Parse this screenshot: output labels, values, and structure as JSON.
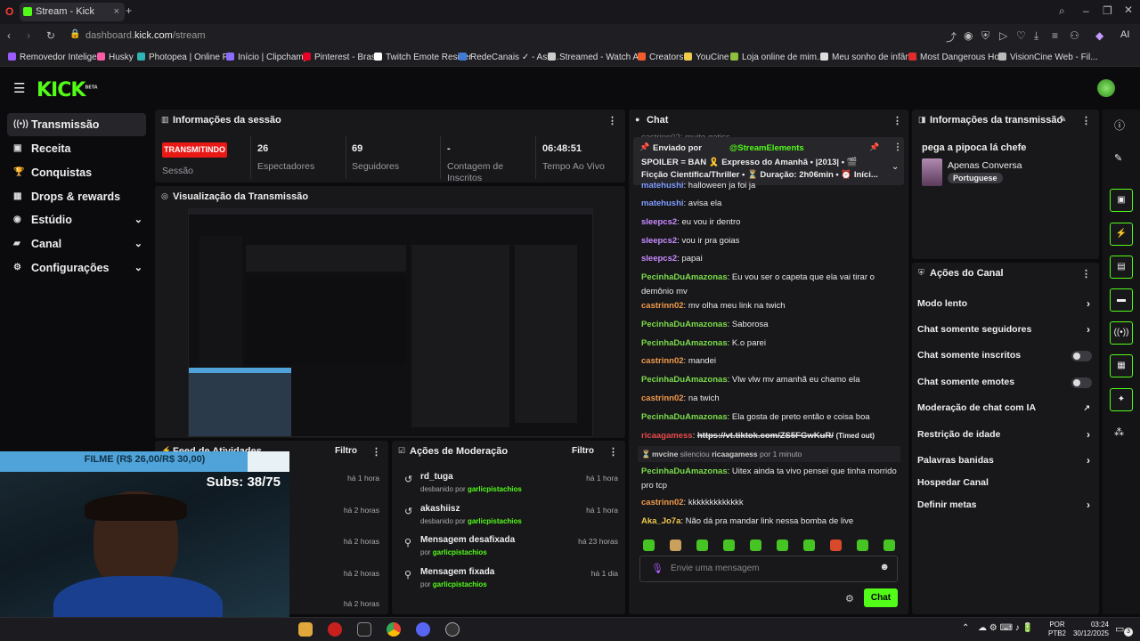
{
  "browser": {
    "tab_title": "Stream - Kick Dashboard",
    "url_prefix": "dashboard.",
    "url_domain": "kick.com",
    "url_path": "/stream",
    "ai_label": "AI",
    "bookmarks": [
      "Removedor Intelige...",
      "Husky",
      "Photopea | Online P...",
      "Início | Clipchamp",
      "Pinterest - Brasil",
      "Twitch Emote Resizer",
      "RedeCanais ✓ - Ass...",
      "Streamed - Watch A...",
      "Creators",
      "YouCine",
      "Loja online de mim...",
      "Meu sonho de infân...",
      "Most Dangerous Ho...",
      "VisionCine Web - Fil..."
    ]
  },
  "app": {
    "logo": "KICK",
    "logo_sup": "BETA"
  },
  "sidebar": {
    "items": [
      {
        "label": "Transmissão"
      },
      {
        "label": "Receita"
      },
      {
        "label": "Conquistas"
      },
      {
        "label": "Drops & rewards"
      },
      {
        "label": "Estúdio"
      },
      {
        "label": "Canal"
      },
      {
        "label": "Configurações"
      }
    ]
  },
  "session": {
    "title": "Informações da sessão",
    "live_badge": "TRANSMITINDO",
    "session_label": "Sessão",
    "viewers_value": "26",
    "viewers_label": "Espectadores",
    "followers_value": "69",
    "followers_label": "Seguidores",
    "subs_value": "-",
    "subs_label": "Contagem de Inscritos",
    "time_value": "06:48:51",
    "time_label": "Tempo Ao Vivo"
  },
  "preview": {
    "title": "Visualização da Transmissão"
  },
  "activity": {
    "title": "Feed de Atividades",
    "filter": "Filtro",
    "times": [
      "há 1 hora",
      "há 2 horas",
      "há 2 horas",
      "há 2 horas",
      "há 2 horas"
    ]
  },
  "webcam": {
    "film_label": "FILME (R$ 26,00/R$ 30,00)",
    "subs_label": "Subs: 38/75"
  },
  "moderation": {
    "title": "Ações de Moderação",
    "filter": "Filtro",
    "rows": [
      {
        "title": "rd_tuga",
        "sub": "desbanido por",
        "by": "garlicpistachios",
        "time": "há 1 hora"
      },
      {
        "title": "akashiisz",
        "sub": "desbanido por",
        "by": "garlicpistachios",
        "time": "há 1 hora"
      },
      {
        "title": "Mensagem desafixada",
        "sub": "por",
        "by": "garlicpistachios",
        "time": "há 23 horas"
      },
      {
        "title": "Mensagem fixada",
        "sub": "por",
        "by": "garlicpistachios",
        "time": "há 1 dia"
      }
    ]
  },
  "chat": {
    "title": "Chat",
    "pinned_by": "Enviado por",
    "pinned_user": "@StreamElements",
    "pinned_line1": "SPOILER = BAN 🎗️ Expresso do Amanhã • |2013| • 🎬",
    "pinned_line2": "Ficção Científica/Thriller • ⏳ Duração: 2h06min • ⏰ Iníci...",
    "partial_top": "castrinn02: muito gatiss",
    "messages": [
      {
        "user": "matehushi",
        "text": "halloween ja foi ja",
        "color": "#7f9cff"
      },
      {
        "user": "matehushi",
        "text": "avisa ela",
        "color": "#7f9cff"
      },
      {
        "user": "sleepcs2",
        "text": "eu vou ir dentro",
        "color": "#c98bff"
      },
      {
        "user": "sleepcs2",
        "text": "vou ir pra goias",
        "color": "#c98bff"
      },
      {
        "user": "sleepcs2",
        "text": "papai",
        "color": "#c98bff"
      },
      {
        "user": "PecinhaDuAmazonas",
        "text": "Eu vou ser o capeta que ela vai tirar o demônio mv",
        "color": "#7bdc4a"
      },
      {
        "user": "castrinn02",
        "text": "mv olha meu link na twich",
        "color": "#f2994a"
      },
      {
        "user": "PecinhaDuAmazonas",
        "text": "Saborosa",
        "color": "#7bdc4a"
      },
      {
        "user": "PecinhaDuAmazonas",
        "text": "K.o parei",
        "color": "#7bdc4a"
      },
      {
        "user": "castrinn02",
        "text": "mandei",
        "color": "#f2994a"
      },
      {
        "user": "PecinhaDuAmazonas",
        "text": "Vlw vlw mv amanhã eu chamo ela",
        "color": "#7bdc4a"
      },
      {
        "user": "castrinn02",
        "text": "na twich",
        "color": "#f2994a"
      },
      {
        "user": "PecinhaDuAmazonas",
        "text": "Ela gosta de preto então e coisa boa",
        "color": "#7bdc4a"
      }
    ],
    "timeout_user": "ricaagamess",
    "timeout_link": "https://vt.tiktok.com/ZS5FGwKuR/",
    "timeout_tag": "(Timed out)",
    "silence_actor": "mvcine",
    "silence_text": "silenciou",
    "silence_target": "ricaagamess",
    "silence_dur": "por 1 minuto",
    "after": [
      {
        "user": "PecinhaDuAmazonas",
        "text": "Uitex ainda ta vivo pensei que tinha morrido pro tcp",
        "color": "#7bdc4a"
      },
      {
        "user": "castrinn02",
        "text": "kkkkkkkkkkkkk",
        "color": "#f2994a"
      },
      {
        "user": "Aka_Jo7a",
        "text": "Não dá pra mandar link nessa bomba de live",
        "color": "#f2c94c"
      }
    ],
    "input_placeholder": "Envie uma mensagem",
    "send": "Chat"
  },
  "stream_info": {
    "title": "Informações da transmissão",
    "stream_title": "pega a pipoca lá chefe",
    "category": "Apenas Conversa",
    "language": "Portuguese"
  },
  "channel_actions": {
    "title": "Ações do Canal",
    "items": [
      "Modo lento",
      "Chat somente seguidores",
      "Chat somente inscritos",
      "Chat somente emotes",
      "Moderação de chat com IA",
      "Restrição de idade",
      "Palavras banidas",
      "Hospedar Canal",
      "Definir metas"
    ]
  },
  "taskbar": {
    "lang1": "POR",
    "lang2": "PTB2",
    "time": "03:24",
    "date": "30/12/2025",
    "notif": "3"
  },
  "colors": {
    "accent": "#53fc18",
    "live": "#e91916",
    "panel": "#18181b"
  }
}
